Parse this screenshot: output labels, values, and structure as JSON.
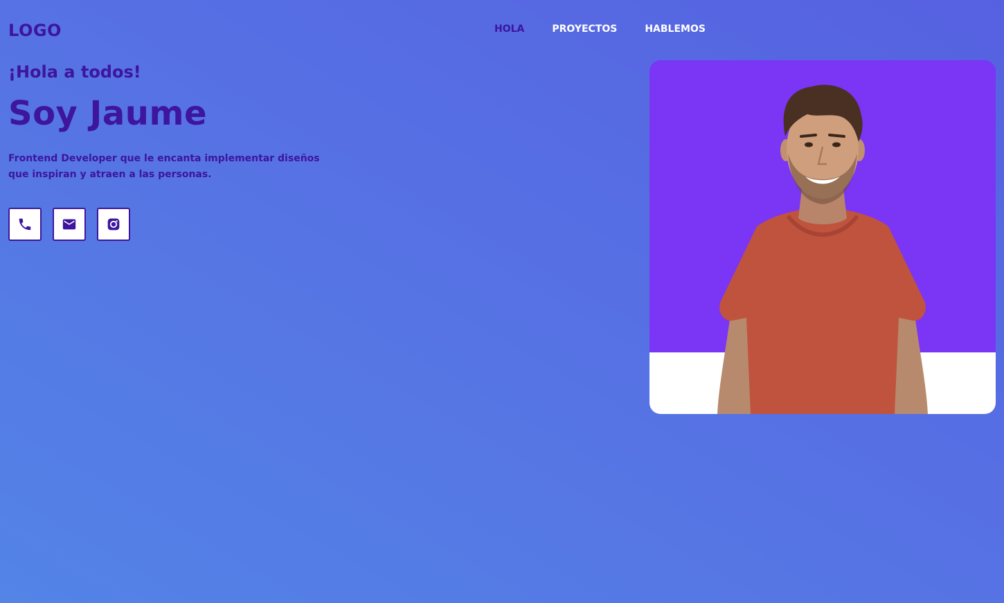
{
  "header": {
    "logo": "LOGO",
    "nav": [
      {
        "label": "HOLA",
        "active": true
      },
      {
        "label": "PROYECTOS",
        "active": false
      },
      {
        "label": "HABLEMOS",
        "active": false
      }
    ]
  },
  "hero": {
    "greeting": "¡Hola a todos!",
    "name": "Soy Jaume",
    "description": "Frontend Developer que le encanta implementar diseños que inspiran y atraen a las personas.",
    "socials": [
      {
        "icon": "phone-icon"
      },
      {
        "icon": "mail-icon"
      },
      {
        "icon": "instagram-icon"
      }
    ]
  },
  "photo": {
    "subject": "portrait-photo"
  },
  "colors": {
    "primary": "#3d159e",
    "nav_text": "#ffffff",
    "photo_bg": "#7a35f5",
    "gradient_start": "#5384e6",
    "gradient_end": "#5661e1",
    "shirt": "#c0533e"
  }
}
